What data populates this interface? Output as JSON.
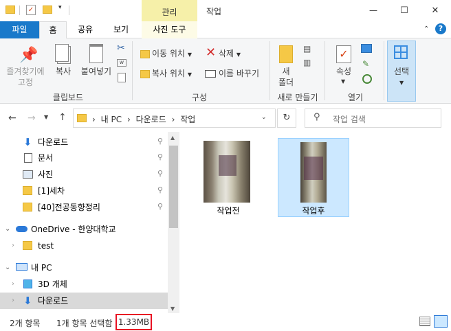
{
  "titlebar": {
    "context_tab": "관리",
    "title": "작업",
    "minimize": "—",
    "maximize": "☐",
    "close": "✕"
  },
  "ribbon_tabs": {
    "file": "파일",
    "home": "홈",
    "share": "공유",
    "view": "보기",
    "picture_tools": "사진 도구",
    "help": "?"
  },
  "ribbon": {
    "clipboard": {
      "pin": "즐겨찾기에\n고정",
      "copy": "복사",
      "paste": "붙여넣기",
      "group": "클립보드"
    },
    "organize": {
      "move": "이동 위치",
      "copy": "복사 위치",
      "delete": "삭제",
      "rename": "이름 바꾸기",
      "group": "구성"
    },
    "new": {
      "folder": "새\n폴더",
      "group": "새로 만들기"
    },
    "open": {
      "properties": "속성",
      "group": "열기"
    },
    "select": {
      "select": "선택"
    }
  },
  "address": {
    "path": [
      "내 PC",
      "다운로드",
      "작업"
    ],
    "search_placeholder": "작업 검색"
  },
  "nav": {
    "quick": [
      {
        "label": "다운로드",
        "icon": "download-icon"
      },
      {
        "label": "문서",
        "icon": "document-icon"
      },
      {
        "label": "사진",
        "icon": "pictures-icon"
      },
      {
        "label": "[1]세차",
        "icon": "folder-icon"
      },
      {
        "label": "[40]전공동향정리",
        "icon": "folder-icon"
      }
    ],
    "onedrive": "OneDrive - 한양대학교",
    "test": "test",
    "thispc": "내 PC",
    "objects3d": "3D 개체",
    "downloads": "다운로드"
  },
  "files": [
    {
      "name": "작업전",
      "selected": false
    },
    {
      "name": "작업후",
      "selected": true
    }
  ],
  "status": {
    "count": "2개 항목",
    "selected": "1개 항목 선택함",
    "size": "1.33MB"
  },
  "colors": {
    "accent": "#1979ca",
    "selection": "#cce8ff",
    "selection_border": "#99d1ff",
    "context_band": "#f6f0a9",
    "status_highlight": "#e81123"
  }
}
